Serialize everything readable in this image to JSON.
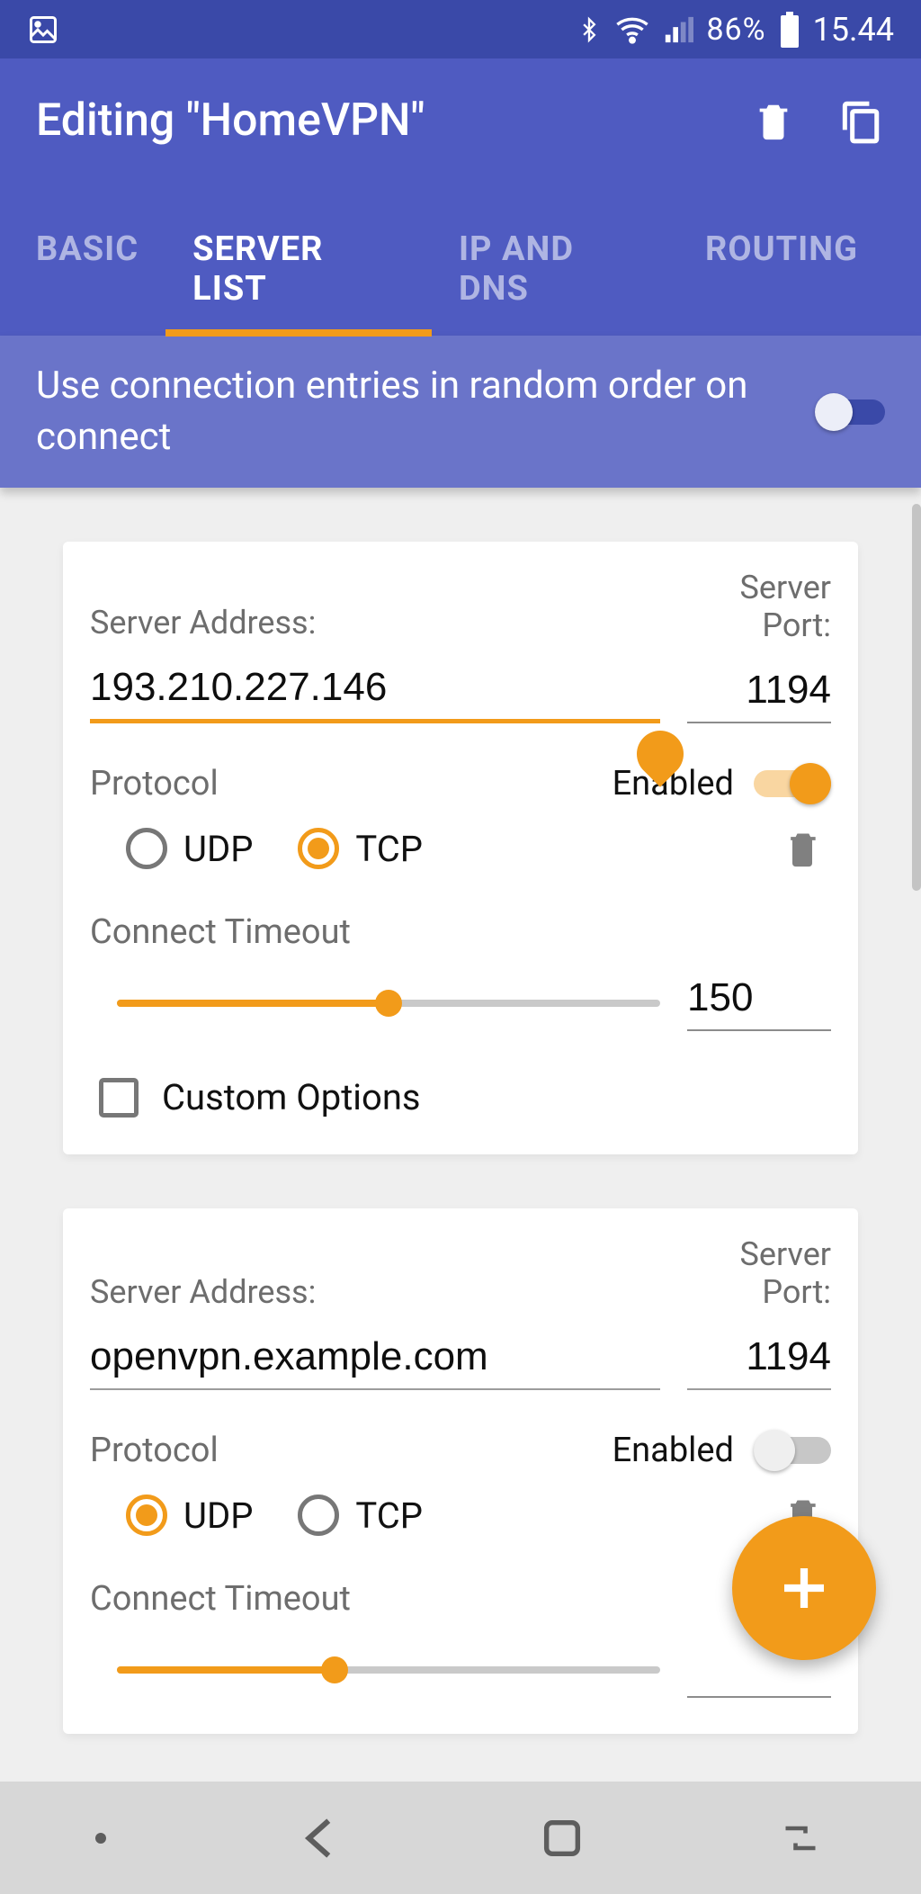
{
  "status": {
    "battery_pct": "86%",
    "time": "15.44"
  },
  "app_bar": {
    "title": "Editing \"HomeVPN\""
  },
  "tabs": [
    "BASIC",
    "SERVER LIST",
    "IP AND DNS",
    "ROUTING"
  ],
  "active_tab_index": 1,
  "random_order": {
    "label": "Use connection entries in random order on connect",
    "enabled": true
  },
  "labels": {
    "server_address": "Server Address:",
    "server_port": "Server Port:",
    "protocol": "Protocol",
    "enabled": "Enabled",
    "udp": "UDP",
    "tcp": "TCP",
    "connect_timeout": "Connect Timeout",
    "custom_options": "Custom Options"
  },
  "servers": [
    {
      "address": "193.210.227.146",
      "port": "1194",
      "address_focused": true,
      "protocol": "TCP",
      "enabled": true,
      "timeout": "150",
      "timeout_fill_pct": 50,
      "custom_options_checked": false
    },
    {
      "address": "openvpn.example.com",
      "port": "1194",
      "address_focused": false,
      "protocol": "UDP",
      "enabled": false,
      "timeout": "",
      "timeout_fill_pct": 40,
      "custom_options_checked": false
    }
  ]
}
